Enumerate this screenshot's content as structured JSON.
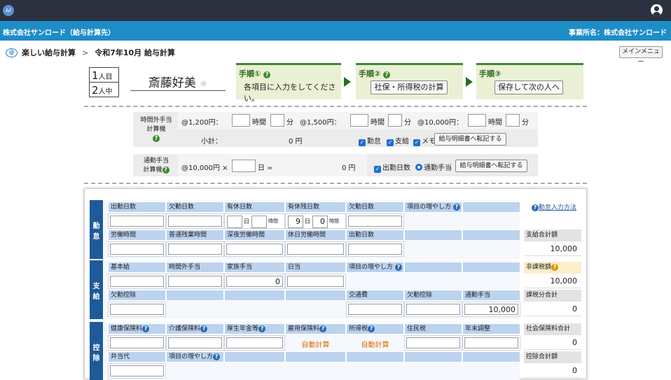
{
  "app": {
    "logo_glyph": "ω"
  },
  "company": {
    "left": "株式会社サンロード（給与計算先）",
    "right": "事業所名：株式会社サンロード"
  },
  "breadcrumb": {
    "app_name": "楽しい給与計算",
    "separator": ">",
    "current": "令和7年10月 給与計算",
    "main_menu": "メインメニュー"
  },
  "counter": {
    "top_num": "1",
    "top_unit": "人目",
    "bottom_num": "2",
    "bottom_unit": "人中"
  },
  "employee": {
    "name": "斎藤好美",
    "marker": "☼"
  },
  "steps": [
    {
      "title": "手順①",
      "desc": "各項目に入力をしてください。"
    },
    {
      "title": "手順②",
      "button": "社保・所得税の計算"
    },
    {
      "title": "手順③",
      "button": "保存して次の人へ"
    }
  ],
  "overtime": {
    "label1": "時間外手当",
    "label2": "計算機",
    "rate1": "@1,200円：",
    "rate2": "@1,500円：",
    "rate3": "@10,000円：",
    "hour": "時間",
    "minute": "分",
    "subtotal_label": "小計：",
    "subtotal_value": "0 円",
    "chk1": "勤怠",
    "chk2": "支給",
    "chk3": "メモ",
    "transfer_btn": "給与明細書へ転記する"
  },
  "commute": {
    "label1": "通勤手当",
    "label2": "計算機",
    "rate": "@10,000円 ×",
    "days_unit": "日 =",
    "result": "0 円",
    "chk1": "出勤日数",
    "radio1": "通勤手当",
    "transfer_btn": "給与明細書へ転記する"
  },
  "sections": {
    "attendance": "勤怠",
    "payment": "支給",
    "deduction": "控除"
  },
  "attendance": {
    "row1_headers": [
      "出勤日数",
      "欠勤日数",
      "有休日数",
      "有休残日数",
      "欠勤日数",
      "項目の増やし方"
    ],
    "day_unit": "日",
    "hour_unit": "時間",
    "paid_left_days": "9",
    "paid_left_hours": "0",
    "row2_headers": [
      "労働時間",
      "普通残業時間",
      "深夜労働時間",
      "休日労働時間",
      "出勤日数"
    ],
    "help_link": "勤怠入力方法"
  },
  "payment": {
    "row1_headers": [
      "基本給",
      "時間外手当",
      "家族手当",
      "日当",
      "項目の増やし方"
    ],
    "family_allowance": "0",
    "row2_headers": [
      "欠勤控除",
      "",
      "",
      "",
      "交通費",
      "欠勤控除",
      "通勤手当"
    ],
    "commute_allowance": "10,000"
  },
  "deduction": {
    "row1_headers": [
      "健康保険料",
      "介護保険料",
      "厚生年金等",
      "雇用保険料",
      "所得税",
      "住民税",
      "年末調整"
    ],
    "auto_calc": "自動計算",
    "row2_headers": [
      "弁当代",
      "項目の増やし方"
    ]
  },
  "summary": {
    "pay_total_label": "支給合計額",
    "pay_total": "10,000",
    "nontax_label": "非課税額",
    "nontax": "10,000",
    "taxable_label": "課税分合計",
    "taxable": "0",
    "social_label": "社会保険料合計",
    "social": "0",
    "deduct_label": "控除合計額",
    "deduct": "0"
  },
  "colors": {
    "header_bg": "#2c3140",
    "company_bar": "#1e8dc7",
    "step_accent": "#3c8a2e",
    "section_bg": "#1e5a9a",
    "auto_calc": "#e06b00"
  }
}
